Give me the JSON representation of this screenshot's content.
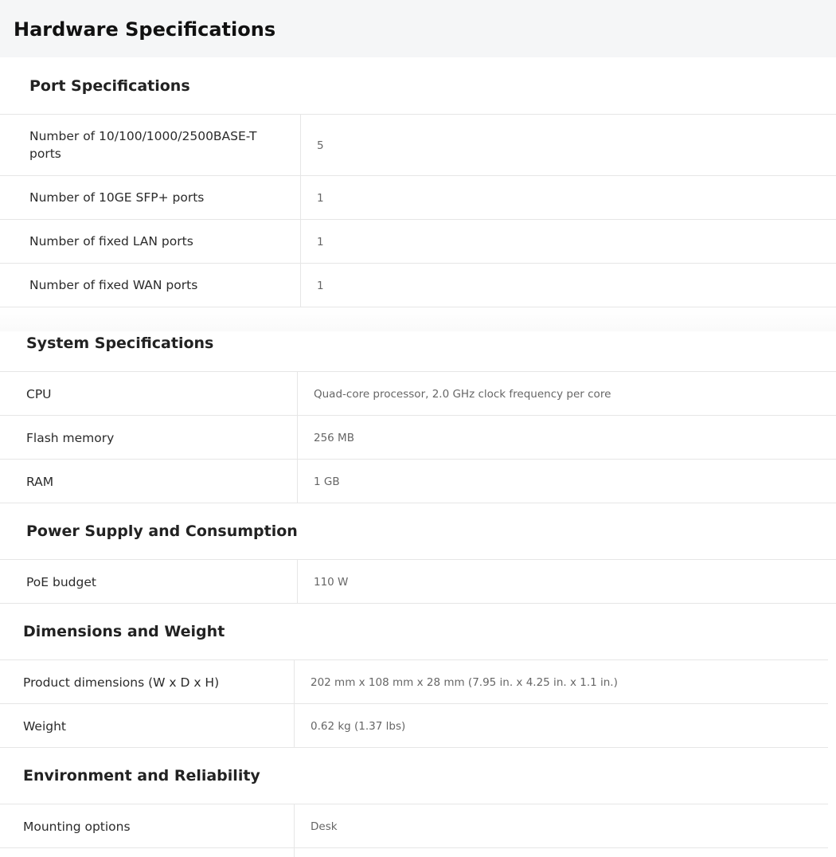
{
  "page": {
    "title": "Hardware Specifications"
  },
  "sections": {
    "port": {
      "title": "Port Specifications",
      "rows": [
        {
          "label": "Number of 10/100/1000/2500BASE-T ports",
          "value": "5"
        },
        {
          "label": "Number of 10GE SFP+ ports",
          "value": "1"
        },
        {
          "label": "Number of fixed LAN ports",
          "value": "1"
        },
        {
          "label": "Number of fixed WAN ports",
          "value": "1"
        }
      ]
    },
    "system": {
      "title": "System Specifications",
      "rows": [
        {
          "label": "CPU",
          "value": "Quad-core processor, 2.0 GHz clock frequency per core"
        },
        {
          "label": "Flash memory",
          "value": "256 MB"
        },
        {
          "label": "RAM",
          "value": "1 GB"
        }
      ]
    },
    "power": {
      "title": "Power Supply and Consumption",
      "rows": [
        {
          "label": "PoE budget",
          "value": "110 W"
        }
      ]
    },
    "dimensions": {
      "title": "Dimensions and Weight",
      "rows": [
        {
          "label": "Product dimensions (W x D x H)",
          "value": "202 mm x 108 mm x 28 mm (7.95 in. x 4.25 in. x 1.1 in.)"
        },
        {
          "label": "Weight",
          "value": "0.62 kg (1.37 lbs)"
        }
      ]
    },
    "environment": {
      "title": "Environment and Reliability",
      "rows": [
        {
          "label": "Mounting options",
          "value": "Desk"
        }
      ]
    }
  }
}
